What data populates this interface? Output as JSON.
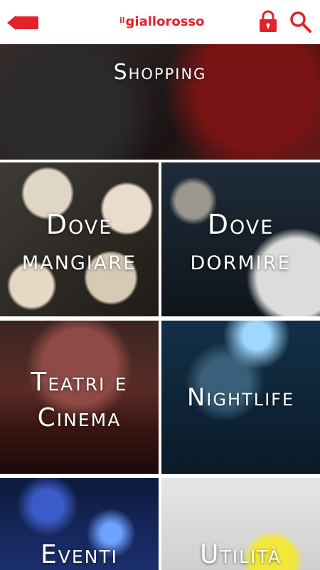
{
  "header": {
    "brand_prefix": "il",
    "brand_name": "giallorosso",
    "back_icon": "arrow-left-icon",
    "lock_icon": "lock-icon",
    "search_icon": "search-icon"
  },
  "colors": {
    "brand_red": "#e3222b",
    "background": "#ffffff",
    "tile_text": "#ffffff"
  },
  "tiles": [
    {
      "label": "Shopping"
    },
    {
      "label_line1": "Dove",
      "label_line2": "mangiare"
    },
    {
      "label_line1": "Dove",
      "label_line2": "dormire"
    },
    {
      "label_line1": "Teatri e",
      "label_line2": "Cinema"
    },
    {
      "label": "Nightlife"
    },
    {
      "label": "Eventi"
    },
    {
      "label": "Utilità"
    }
  ]
}
